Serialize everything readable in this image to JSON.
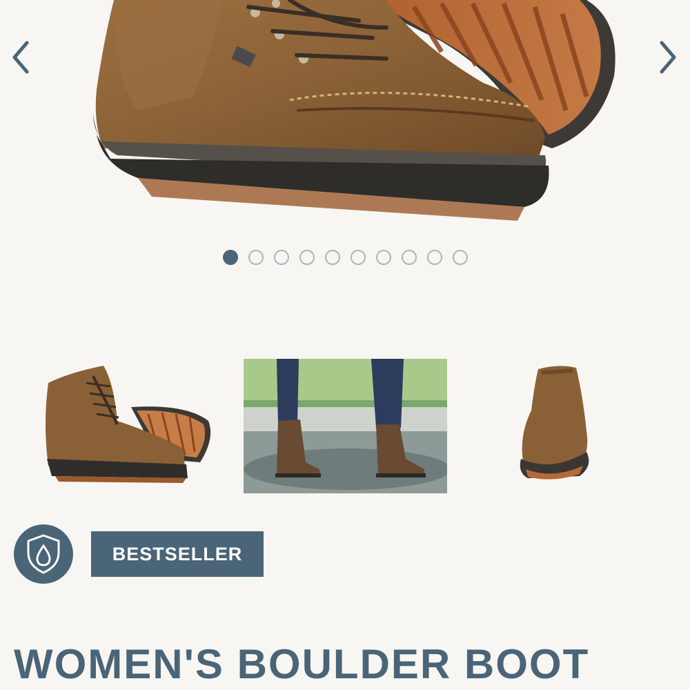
{
  "carousel": {
    "prev_icon": "chevron-left-icon",
    "next_icon": "chevron-right-icon",
    "slide_count": 10,
    "active_slide": 1,
    "arrow_color": "#4a6478"
  },
  "thumbnails": [
    {
      "icon": "boot-pair-thumbnail"
    },
    {
      "icon": "boots-in-puddle-thumbnail"
    },
    {
      "icon": "boot-back-view-thumbnail"
    }
  ],
  "badges": {
    "waterproof_icon": "waterproof-shield-icon",
    "bestseller_label": "BESTSELLER",
    "color": "#4a6478"
  },
  "product": {
    "title": "WOMEN'S BOULDER BOOT"
  },
  "colors": {
    "background": "#f8f6f2",
    "accent": "#4a6478",
    "leather": "#8a6238",
    "sole": "#3a3a3a"
  }
}
